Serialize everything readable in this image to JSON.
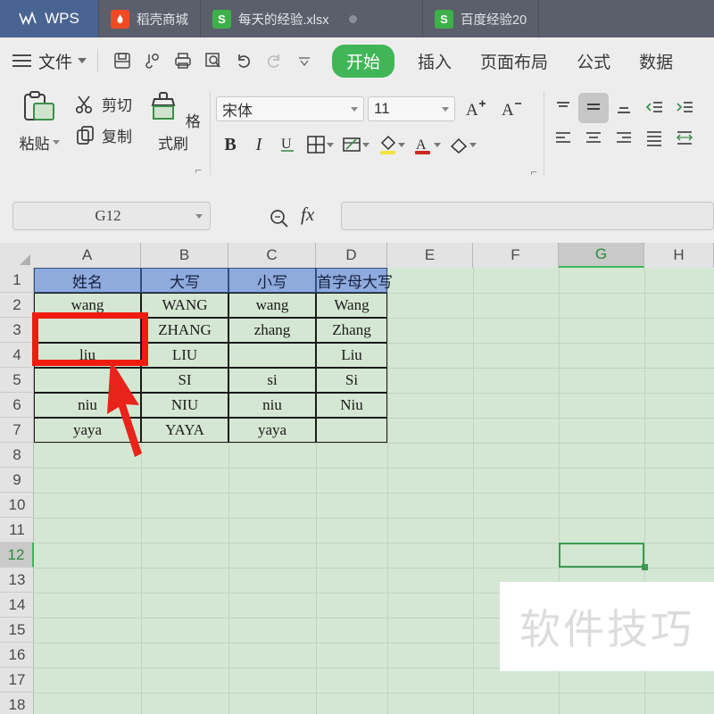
{
  "window": {
    "home_label": "WPS",
    "home_icon": "wps-logo-icon",
    "tabs": [
      {
        "label": "稻壳商城",
        "icon": "dock-store-icon",
        "active": false,
        "has_dot": false
      },
      {
        "label": "每天的经验.xlsx",
        "icon": "spreadsheet-icon",
        "active": true,
        "has_dot": true
      },
      {
        "label": "百度经验20",
        "icon": "spreadsheet-icon",
        "active": false,
        "has_dot": false
      }
    ]
  },
  "menubar": {
    "file_label": "文件",
    "menu_icon": "hamburger-icon",
    "quick_access": [
      {
        "name": "save-icon",
        "glyph": "save"
      },
      {
        "name": "output-pdf-icon",
        "glyph": "output"
      },
      {
        "name": "print-icon",
        "glyph": "print"
      },
      {
        "name": "print-preview-icon",
        "glyph": "preview"
      },
      {
        "name": "undo-icon",
        "glyph": "undo"
      },
      {
        "name": "redo-icon",
        "glyph": "redo"
      },
      {
        "name": "customize-toolbar-icon",
        "glyph": "chevron"
      }
    ],
    "ribbon_tabs": [
      {
        "label": "开始",
        "active": true
      },
      {
        "label": "插入",
        "active": false
      },
      {
        "label": "页面布局",
        "active": false
      },
      {
        "label": "公式",
        "active": false
      },
      {
        "label": "数据",
        "active": false
      }
    ]
  },
  "toolbar": {
    "paste_label": "粘贴",
    "cut_label": "剪切",
    "copy_label": "复制",
    "format_painter_label": "格式刷",
    "font_name": "宋体",
    "font_size": "11",
    "grow_font": "A",
    "shrink_font": "A",
    "bold": "B",
    "italic": "I",
    "underline": "U",
    "expand_corner": "⌐"
  },
  "formula_bar": {
    "name_box_value": "G12",
    "search_icon": "search-function-icon",
    "fx_label": "fx",
    "formula_value": "",
    "formula_placeholder": ""
  },
  "grid": {
    "columns": [
      "A",
      "B",
      "C",
      "D",
      "E",
      "F",
      "G",
      "H"
    ],
    "selected_column": "G",
    "rows": [
      "1",
      "2",
      "3",
      "4",
      "5",
      "6",
      "7",
      "8",
      "9",
      "10",
      "11",
      "12",
      "13",
      "14",
      "15",
      "16",
      "17",
      "18"
    ],
    "selected_row": "12",
    "selected_cell": "G12",
    "headers": [
      "姓名",
      "大写",
      "小写",
      "首字母大写"
    ],
    "data": [
      [
        "wang",
        "WANG",
        "wang",
        "Wang"
      ],
      [
        "",
        "ZHANG",
        "zhang",
        "Zhang"
      ],
      [
        "liu",
        "LIU",
        "",
        "Liu"
      ],
      [
        "",
        "SI",
        "si",
        "Si"
      ],
      [
        "niu",
        "NIU",
        "niu",
        "Niu"
      ],
      [
        "yaya",
        "YAYA",
        "yaya",
        ""
      ]
    ]
  },
  "annotations": {
    "highlight_rect": "red-highlight-rectangle",
    "pointer_arrow": "red-arrow-annotation",
    "watermark_text": "软件技巧"
  },
  "colors": {
    "titlebar": "#5a5f6b",
    "wps_blue": "#4a6491",
    "ribbon_active": "#41b658",
    "sheet_bg": "#d4e7d2",
    "header_fill": "#8faadc",
    "annotation_red": "#f01c0f",
    "selection_green": "#3a9b4e"
  }
}
